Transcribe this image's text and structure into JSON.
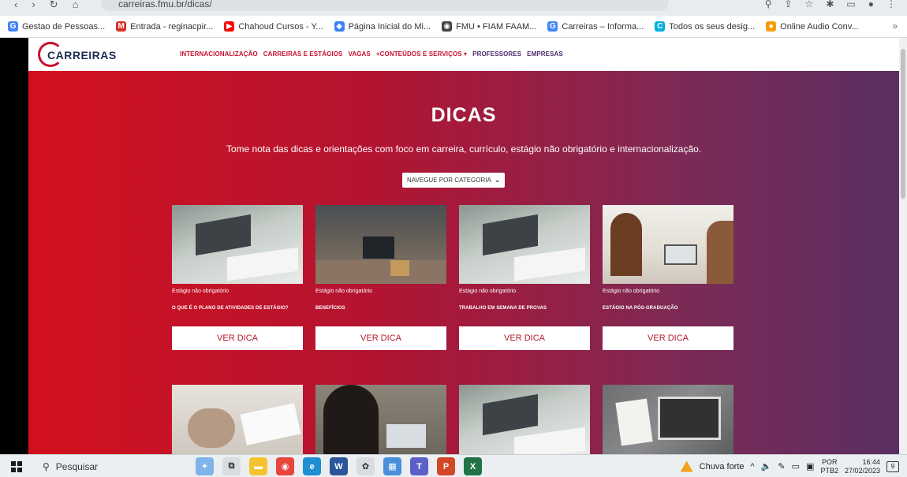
{
  "browser": {
    "address": "carreiras.fmu.br/dicas/",
    "bookmarks": [
      {
        "label": "Gestao de Pessoas...",
        "icon": "google-icon",
        "color": "#4285f4",
        "glyph": "G"
      },
      {
        "label": "Entrada - reginacpir...",
        "icon": "gmail-icon",
        "color": "#d93025",
        "glyph": "M"
      },
      {
        "label": "Chahoud Cursos - Y...",
        "icon": "youtube-icon",
        "color": "#ff0000",
        "glyph": "▶"
      },
      {
        "label": "Página Inicial do Mi...",
        "icon": "microsoft-icon",
        "color": "#3b82f6",
        "glyph": "◆"
      },
      {
        "label": "FMU • FIAM FAAM...",
        "icon": "globe-icon",
        "color": "#444444",
        "glyph": "◉"
      },
      {
        "label": "Carreiras – Informa...",
        "icon": "google-icon",
        "color": "#4285f4",
        "glyph": "G"
      },
      {
        "label": "Todos os seus desig...",
        "icon": "canva-icon",
        "color": "#00b0d8",
        "glyph": "C"
      },
      {
        "label": "Online Audio Conv...",
        "icon": "audio-converter-icon",
        "color": "#f59e0b",
        "glyph": "●"
      }
    ],
    "more": "»"
  },
  "site": {
    "logo": "CARREIRAS",
    "nav": [
      {
        "label": "INTERNACIONALIZAÇÃO"
      },
      {
        "label": "CARREIRAS E ESTÁGIOS"
      },
      {
        "label": "VAGAS"
      },
      {
        "label": "+CONTEÚDOS E SERVIÇOS ▾"
      },
      {
        "label": "PROFESSORES"
      },
      {
        "label": "EMPRESAS"
      }
    ]
  },
  "hero": {
    "title": "DICAS",
    "subtitle": "Tome nota das dicas e orientações com foco em carreira, currículo, estágio não obrigatório e internacionalização.",
    "category_select": "NAVEGUE POR CATEGORIA"
  },
  "cards": [
    {
      "category": "Estágio não obrigatório",
      "title": "O QUE É O PLANO DE ATIVIDADES DE ESTÁGIO?",
      "button": "VER DICA"
    },
    {
      "category": "Estágio não obrigatório",
      "title": "BENEFÍCIOS",
      "button": "VER DICA"
    },
    {
      "category": "Estágio não obrigatório",
      "title": "TRABALHO EM SEMANA DE PROVAS",
      "button": "VER DICA"
    },
    {
      "category": "Estágio não obrigatório",
      "title": "ESTÁGIO NA PÓS-GRADUAÇÃO",
      "button": "VER DICA"
    }
  ],
  "taskbar": {
    "search": "Pesquisar",
    "weather": "Chuva forte",
    "lang_top": "POR",
    "lang_bottom": "PTB2",
    "time": "16:44",
    "date": "27/02/2023",
    "notifications": "9"
  }
}
